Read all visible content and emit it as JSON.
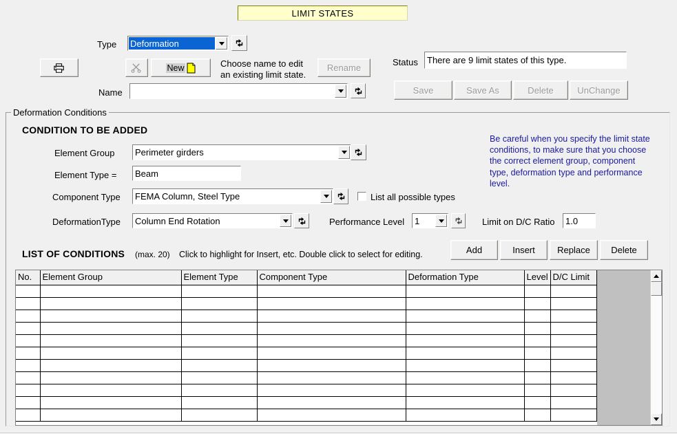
{
  "window": {
    "banner_title": "LIMIT STATES"
  },
  "top": {
    "type_label": "Type",
    "type_value": "Deformation",
    "print_icon": "printer-icon",
    "cut_icon": "scissors-icon",
    "new_label": "New",
    "choose_hint_line1": "Choose name to edit",
    "choose_hint_line2": "an existing limit state.",
    "rename_label": "Rename",
    "name_label": "Name",
    "name_value": "",
    "status_label": "Status",
    "status_value": "There are 9 limit states of this type.",
    "save_label": "Save",
    "save_as_label": "Save As",
    "delete_label": "Delete",
    "unchange_label": "UnChange"
  },
  "conditions": {
    "group_legend": "Deformation Conditions",
    "heading": "CONDITION TO BE ADDED",
    "element_group_label": "Element Group",
    "element_group_value": "Perimeter girders",
    "element_type_label": "Element Type =",
    "element_type_value": "Beam",
    "component_type_label": "Component Type",
    "component_type_value": "FEMA Column, Steel Type",
    "list_all_label": "List all possible types",
    "list_all_checked": false,
    "deformation_type_label": "DeformationType",
    "deformation_type_value": "Column End Rotation",
    "performance_level_label": "Performance Level",
    "performance_level_value": "1",
    "dc_ratio_label": "Limit on D/C Ratio",
    "dc_ratio_value": "1.0",
    "note": "Be careful when you specify the limit state conditions, to make sure that you choose the correct element group, component type, deformation type and performance level."
  },
  "list": {
    "title": "LIST OF CONDITIONS",
    "max_note": "(max. 20)",
    "hint": "Click to highlight for Insert, etc. Double click to select for editing.",
    "add_label": "Add",
    "insert_label": "Insert",
    "replace_label": "Replace",
    "delete_label": "Delete",
    "columns": [
      "No.",
      "Element Group",
      "Element Type",
      "Component Type",
      "Deformation Type",
      "Level",
      "D/C Limit"
    ],
    "rows": [
      [
        "",
        "",
        "",
        "",
        "",
        "",
        ""
      ],
      [
        "",
        "",
        "",
        "",
        "",
        "",
        ""
      ],
      [
        "",
        "",
        "",
        "",
        "",
        "",
        ""
      ],
      [
        "",
        "",
        "",
        "",
        "",
        "",
        ""
      ],
      [
        "",
        "",
        "",
        "",
        "",
        "",
        ""
      ],
      [
        "",
        "",
        "",
        "",
        "",
        "",
        ""
      ],
      [
        "",
        "",
        "",
        "",
        "",
        "",
        ""
      ],
      [
        "",
        "",
        "",
        "",
        "",
        "",
        ""
      ],
      [
        "",
        "",
        "",
        "",
        "",
        "",
        ""
      ],
      [
        "",
        "",
        "",
        "",
        "",
        "",
        ""
      ],
      [
        "",
        "",
        "",
        "",
        "",
        "",
        ""
      ]
    ]
  },
  "colors": {
    "banner_bg": "#ffffcc",
    "banner_border": "#808000",
    "window_bg": "#f0f0f0",
    "selection_blue": "#0a64d2",
    "note_blue": "#1a1a9e",
    "filler_gray": "#c0c0c0"
  }
}
